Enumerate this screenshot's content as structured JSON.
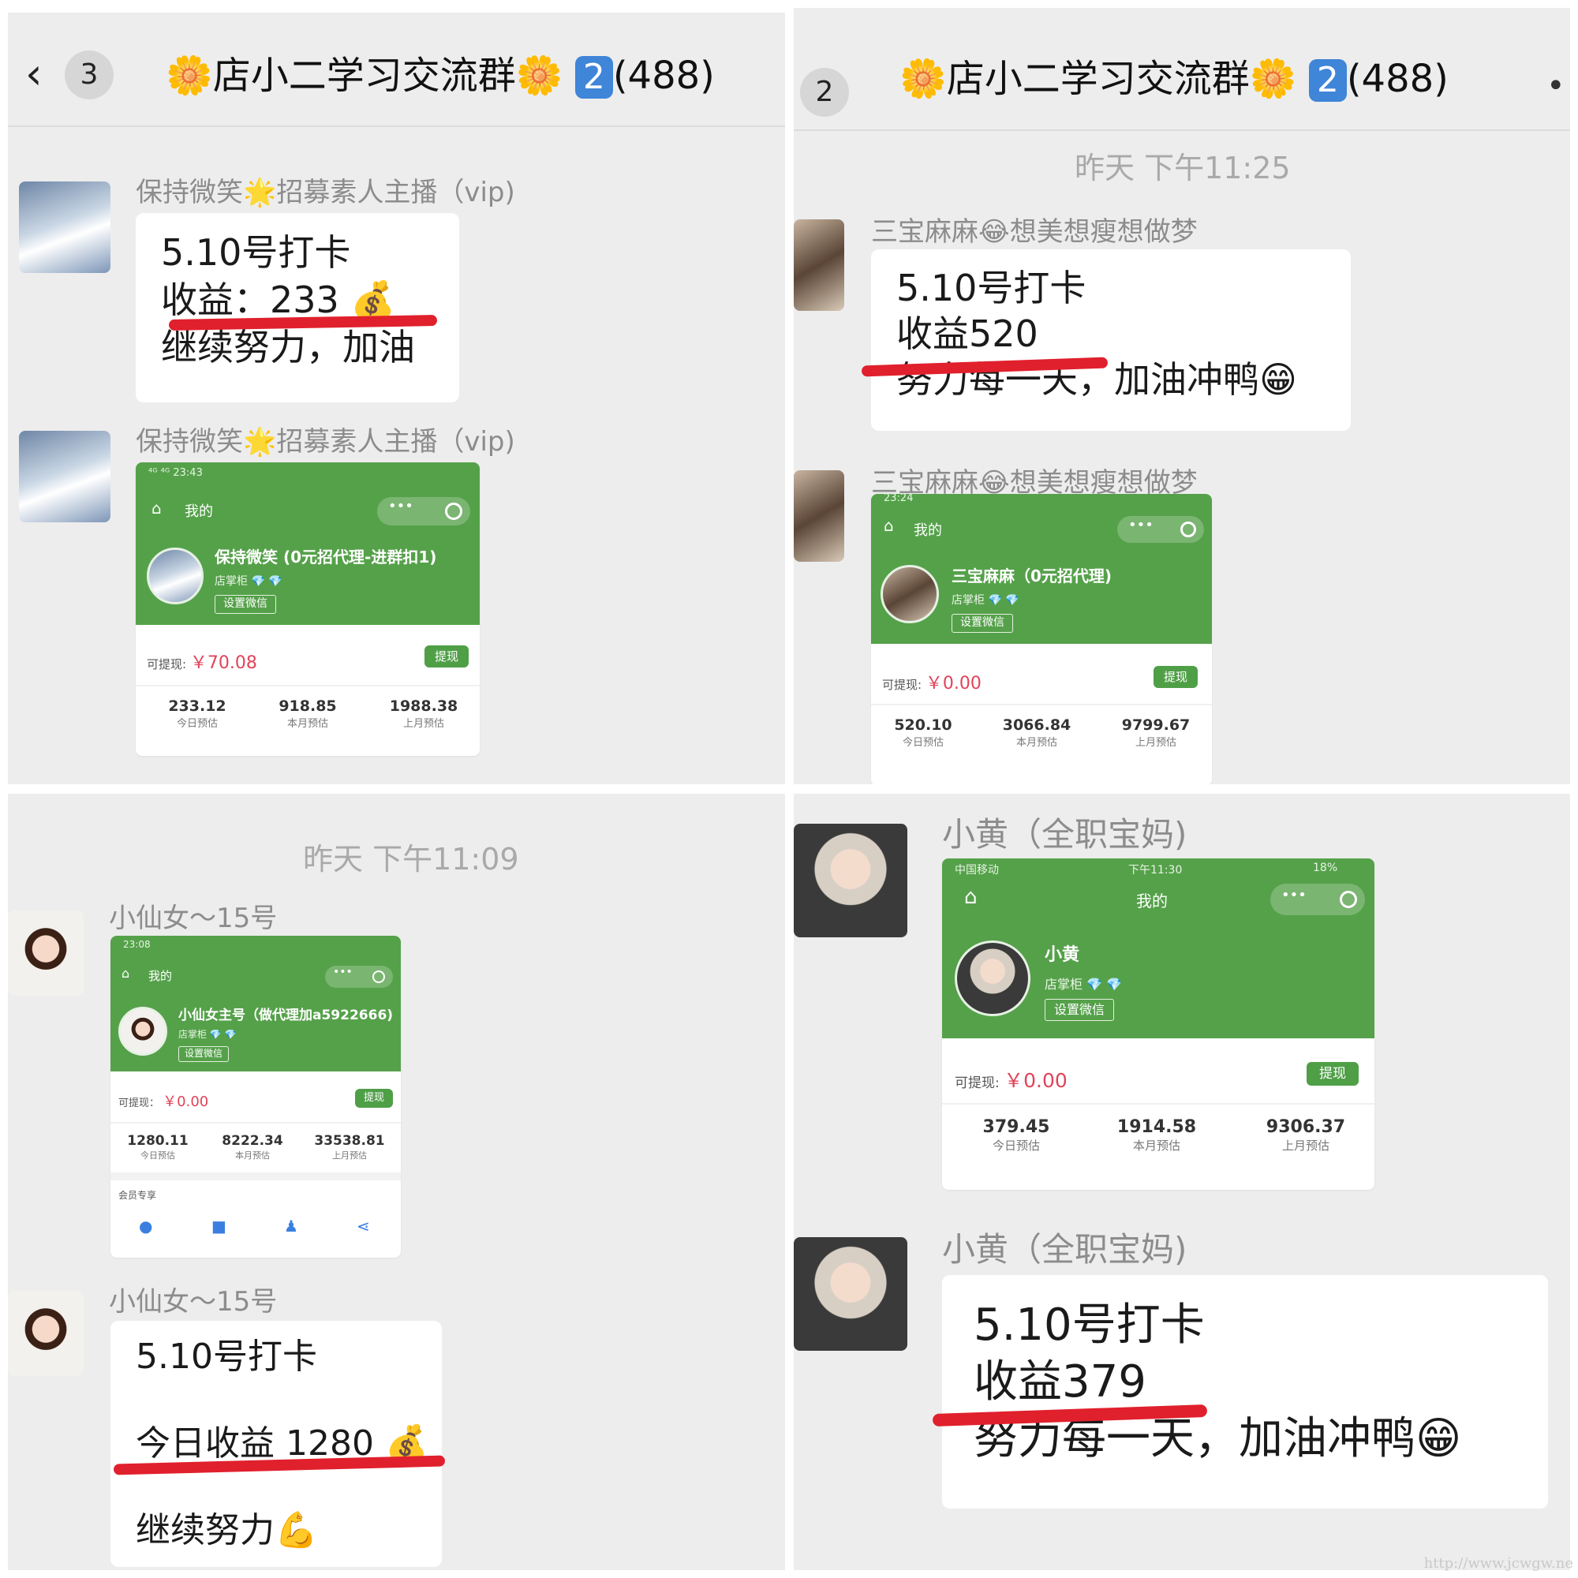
{
  "colors": {
    "accent_green": "#55a14a",
    "money_red": "#e0445a",
    "underline_red": "#e0202c",
    "kbox_blue": "#3f85d8"
  },
  "header": {
    "back_icon": "chevron-left-icon",
    "unread_left": "3",
    "unread_right": "2",
    "flower_icon": "🌼",
    "title": "店小二学习交流群",
    "keycap": "2",
    "member_count": "(488)",
    "more_icon": "•"
  },
  "p1": {
    "sender": "保持微笑🌟招募素人主播（vip)",
    "msg_lines": [
      "5.10号打卡",
      "收益：233 💰",
      "继续努力，加油"
    ],
    "card": {
      "status": "⁴ᴳ ⁴ᴳ 23:43",
      "me": "我的",
      "name": "保持微笑 (0元招代理-进群扣1)",
      "rank": "店掌柜 💎 💎",
      "set_wechat": "设置微信",
      "avail_label": "可提现:",
      "avail_amount": "￥70.08",
      "withdraw": "提现",
      "stats": [
        {
          "value": "233.12",
          "label": "今日预估"
        },
        {
          "value": "918.85",
          "label": "本月预估"
        },
        {
          "value": "1988.38",
          "label": "上月预估"
        }
      ]
    }
  },
  "p2": {
    "time": "昨天 下午11:25",
    "sender": "三宝麻麻😂想美想瘦想做梦",
    "msg_lines": [
      "5.10号打卡",
      "收益520",
      "努力每一天，加油冲鸭😁"
    ],
    "card": {
      "status": "23:24",
      "me": "我的",
      "name": "三宝麻麻（0元招代理)",
      "rank": "店掌柜 💎 💎",
      "set_wechat": "设置微信",
      "avail_label": "可提现:",
      "avail_amount": "￥0.00",
      "withdraw": "提现",
      "stats": [
        {
          "value": "520.10",
          "label": "今日预估"
        },
        {
          "value": "3066.84",
          "label": "本月预估"
        },
        {
          "value": "9799.67",
          "label": "上月预估"
        }
      ]
    }
  },
  "p3": {
    "time": "昨天 下午11:09",
    "sender": "小仙女～15号",
    "msg_lines": [
      "5.10号打卡",
      "今日收益 1280 💰",
      "继续努力💪"
    ],
    "card": {
      "status": "23:08",
      "me": "我的",
      "name": "小仙女主号（做代理加a5922666)",
      "rank": "店掌柜 💎 💎",
      "set_wechat": "设置微信",
      "avail_label": "可提现：",
      "avail_amount": "￥0.00",
      "withdraw": "提现",
      "stats": [
        {
          "value": "1280.11",
          "label": "今日预估"
        },
        {
          "value": "8222.34",
          "label": "本月预估"
        },
        {
          "value": "33538.81",
          "label": "上月预估"
        }
      ],
      "member_title": "会员专享"
    }
  },
  "p4": {
    "sender": "小黄（全职宝妈)",
    "msg_lines": [
      "5.10号打卡",
      "收益379",
      "努力每一天，加油冲鸭😁"
    ],
    "card": {
      "status_left": "中国移动",
      "status_time": "下午11:30",
      "status_right": "18%",
      "me": "我的",
      "name": "小黄",
      "rank": "店掌柜 💎 💎",
      "set_wechat": "设置微信",
      "avail_label": "可提现:",
      "avail_amount": "￥0.00",
      "withdraw": "提现",
      "stats": [
        {
          "value": "379.45",
          "label": "今日预估"
        },
        {
          "value": "1914.58",
          "label": "本月预估"
        },
        {
          "value": "9306.37",
          "label": "上月预估"
        }
      ]
    }
  },
  "watermark": "http://www.jcwgw.ne"
}
